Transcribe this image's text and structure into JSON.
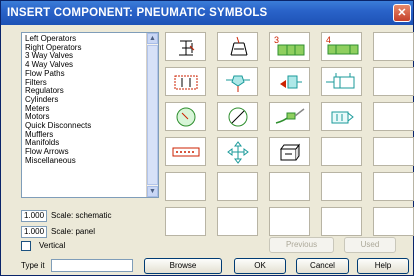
{
  "window": {
    "title": "INSERT COMPONENT: PNEUMATIC SYMBOLS",
    "close_glyph": "✕"
  },
  "categories": [
    "Left Operators",
    "Right Operators",
    "3 Way Valves",
    "4 Way Valves",
    "Flow Paths",
    "Filters",
    "Regulators",
    "Cylinders",
    "Meters",
    "Motors",
    "Quick Disconnects",
    "Mufflers",
    "Manifolds",
    "Flow Arrows",
    "Miscellaneous"
  ],
  "symbols": {
    "row1": [
      {
        "icon": "left-operator-icon"
      },
      {
        "icon": "right-operator-icon"
      },
      {
        "icon": "3-way-valve-icon",
        "label": "3"
      },
      {
        "icon": "4-way-valve-icon",
        "label": "4"
      }
    ],
    "row2": [
      {
        "icon": "flow-path-icon"
      },
      {
        "icon": "filter-icon"
      },
      {
        "icon": "regulator-icon"
      },
      {
        "icon": "cylinder-icon"
      }
    ],
    "row3": [
      {
        "icon": "meter-icon"
      },
      {
        "icon": "motor-icon"
      },
      {
        "icon": "quick-disconnect-icon"
      },
      {
        "icon": "muffler-icon"
      }
    ],
    "row4": [
      {
        "icon": "manifold-icon"
      },
      {
        "icon": "flow-arrow-icon"
      },
      {
        "icon": "miscellaneous-icon"
      }
    ]
  },
  "scale": {
    "schematic_value": "1.000",
    "schematic_label": "Scale: schematic",
    "panel_value": "1.000",
    "panel_label": "Scale: panel"
  },
  "vertical_label": "Vertical",
  "type_it_label": "Type it",
  "buttons": {
    "browse": "Browse",
    "ok": "OK",
    "cancel": "Cancel",
    "help": "Help",
    "previous": "Previous",
    "used": "Used"
  },
  "colors": {
    "accent_red": "#cc2200",
    "symbol_green": "#2f8f2f",
    "symbol_teal": "#1a9a9a",
    "titlebar": "#1d52b6"
  }
}
